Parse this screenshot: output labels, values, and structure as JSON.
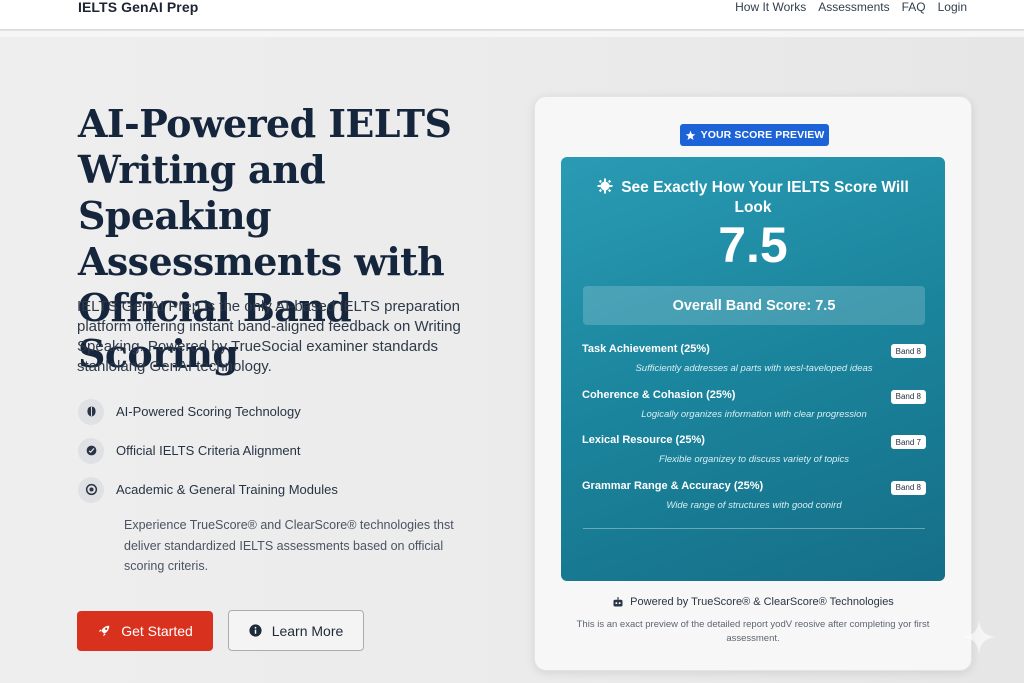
{
  "header": {
    "brand": "IELTS GenAI Prep",
    "nav": [
      "How It Works",
      "Assessments",
      "FAQ",
      "Login"
    ]
  },
  "hero": {
    "title": "AI-Powered IELTS Writing and Speaking Assessments with Official Band Scoring",
    "description": "IELTS GenAI Prep is the only AI-based IELTS preparation platform offering instant band-aligned feedback on Writing Speaking. Powered by TrueSocial examiner standards stanlolang GenAI technology.",
    "features": [
      {
        "icon": "brain-icon",
        "label": "AI-Powered Scoring Technology"
      },
      {
        "icon": "check-badge-icon",
        "label": "Official IELTS Criteria Alignment"
      },
      {
        "icon": "target-icon",
        "label": "Academic & General Training Modules"
      }
    ],
    "sub_description": "Experience TrueScore® and ClearScore® technologies thst deliver standardized IELTS assessments based on official scoring criteris.",
    "primary_button": "Get Started",
    "secondary_button": "Learn More"
  },
  "preview": {
    "pill": "YOUR SCORE PREVIEW",
    "heading": "See Exactly How Your IELTS Score Will Look",
    "score": "7.5",
    "overall": "Overall Band Score: 7.5",
    "criteria": [
      {
        "name": "Task Achievement (25%)",
        "band": "Band 8",
        "desc": "Sufficiently addresses al parts with wesl-taveloped ideas"
      },
      {
        "name": "Coherence & Cohasion (25%)",
        "band": "Band 8",
        "desc": "Logically organizes information with clear progression"
      },
      {
        "name": "Lexical Resource (25%)",
        "band": "Band 7",
        "desc": "Flexible organizey to discuss variety of topics"
      },
      {
        "name": "Grammar Range & Accuracy (25%)",
        "band": "Band 8",
        "desc": "Wide range of structures with good conird"
      }
    ],
    "powered": "Powered by TrueScore® & ClearScore® Technologies",
    "footnote": "This is an exact preview of the detailed report yodV reosive after completing yor first assessment."
  },
  "colors": {
    "accent_red": "#d8321f",
    "pill_blue": "#1d63d8",
    "panel_teal": "#1a849c"
  }
}
